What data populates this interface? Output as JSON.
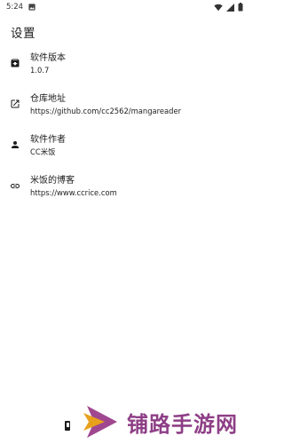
{
  "status_bar": {
    "time": "5:24",
    "icons": [
      "image-icon",
      "wifi-icon",
      "cell-signal-icon",
      "battery-icon"
    ]
  },
  "page": {
    "title": "设置"
  },
  "settings": [
    {
      "icon": "archive-icon",
      "title": "软件版本",
      "subtitle": "1.0.7"
    },
    {
      "icon": "open-in-new-icon",
      "title": "仓库地址",
      "subtitle": "https://github.com/cc2562/mangareader"
    },
    {
      "icon": "person-icon",
      "title": "软件作者",
      "subtitle": "CC米饭"
    },
    {
      "icon": "link-icon",
      "title": "米饭的博客",
      "subtitle": "https://www.ccrice.com"
    }
  ],
  "watermark": {
    "text": "铺路手游网",
    "color": "#8e3f86"
  }
}
